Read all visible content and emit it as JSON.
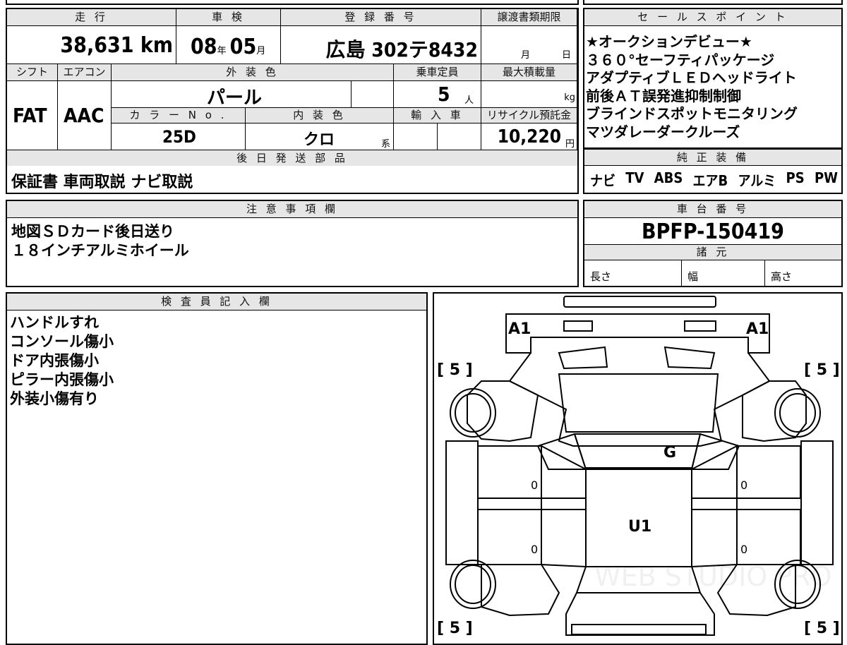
{
  "vehicle": {
    "headers": {
      "mileage": "走 行",
      "inspection": "車 検",
      "registration": "登 録 番 号",
      "transfer_deadline": "譲渡書類期限",
      "shift": "シフト",
      "aircon": "エアコン",
      "exterior_color": "外 装 色",
      "capacity": "乗車定員",
      "max_load": "最大積載量",
      "color_no": "カ ラ ー N o .",
      "interior_color": "内 装 色",
      "import": "輸 入 車",
      "recycle_fee": "リサイクル預託金",
      "later_parts": "後 日 発 送 部 品"
    },
    "mileage": "38,631 km",
    "inspection_year": "08",
    "inspection_year_unit": "年",
    "inspection_month": "05",
    "inspection_month_unit": "月",
    "registration": "広島 302テ8432",
    "transfer_month_unit": "月",
    "transfer_day_unit": "日",
    "shift": "FAT",
    "aircon": "AAC",
    "exterior_color": "パール",
    "capacity": "5",
    "capacity_unit": "人",
    "max_load_unit": "kg",
    "color_no": "25D",
    "interior_color": "クロ",
    "interior_suffix": "系",
    "recycle_fee": "10,220",
    "recycle_fee_unit": "円",
    "later_parts": "保証書 車両取説 ナビ取説"
  },
  "sales_points": {
    "header": "セ ー ル ス ポ イ ン ト",
    "items": [
      "★オークションデビュー★",
      "３６０°セーフティパッケージ",
      "アダプティブＬＥＤヘッドライト",
      "前後ＡＴ誤発進抑制制御",
      "ブラインドスポットモニタリング",
      "マツダレーダークルーズ"
    ]
  },
  "equipment": {
    "header": "純 正 装 備",
    "items": [
      "ナビ",
      "TV",
      "ABS",
      "エアB",
      "アルミ",
      "PS",
      "PW"
    ]
  },
  "notes": {
    "header": "注 意 事 項 欄",
    "lines": [
      "地図ＳＤカード後日送り",
      "１８インチアルミホイール"
    ]
  },
  "chassis": {
    "header": "車 台 番 号",
    "number": "BPFP-150419",
    "specs_header": "諸 元",
    "length_label": "長さ",
    "width_label": "幅",
    "height_label": "高さ"
  },
  "inspector": {
    "header": "検 査 員 記 入 欄",
    "lines": [
      "ハンドルすれ",
      "コンソール傷小",
      "ドア内張傷小",
      "ピラー内張傷小",
      "外装小傷有り"
    ]
  },
  "diagram": {
    "mark_a1_left": "A1",
    "mark_a1_right": "A1",
    "mark_g": "G",
    "mark_u1": "U1",
    "tire_fl": "[ 5 ]",
    "tire_fr": "[ 5 ]",
    "tire_rl": "[ 5 ]",
    "tire_rr": "[ 5 ]",
    "door_fl": "0",
    "door_rl": "0",
    "door_fr": "0",
    "door_rr": "0",
    "watermark": "WEB STUDIO PRO"
  }
}
